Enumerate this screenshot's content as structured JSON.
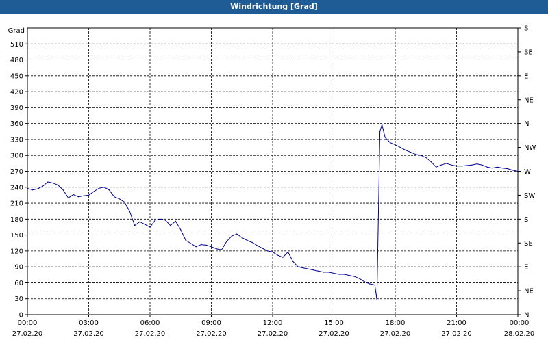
{
  "window": {
    "title": "Windrichtung [Grad]"
  },
  "chart_data": {
    "type": "line",
    "title": "Windrichtung [Grad]",
    "ylabel": "Grad",
    "ylim": [
      0,
      540
    ],
    "yticks": [
      0,
      30,
      60,
      90,
      120,
      150,
      180,
      210,
      240,
      270,
      300,
      330,
      360,
      390,
      420,
      450,
      480,
      510
    ],
    "x_range_hours": [
      0,
      24
    ],
    "x_ticks": [
      {
        "time": "00:00",
        "date": "27.02.20"
      },
      {
        "time": "03:00",
        "date": "27.02.20"
      },
      {
        "time": "06:00",
        "date": "27.02.20"
      },
      {
        "time": "09:00",
        "date": "27.02.20"
      },
      {
        "time": "12:00",
        "date": "27.02.20"
      },
      {
        "time": "15:00",
        "date": "27.02.20"
      },
      {
        "time": "18:00",
        "date": "27.02.20"
      },
      {
        "time": "21:00",
        "date": "27.02.20"
      },
      {
        "time": "00:00",
        "date": "28.02.20"
      }
    ],
    "right_axis_labels": [
      "N",
      "NE",
      "E",
      "SE",
      "S",
      "SW",
      "W",
      "NW",
      "N",
      "NE",
      "E",
      "SE",
      "S"
    ],
    "grid": true,
    "color": "#00008b",
    "series": [
      {
        "x": [
          0,
          0.25,
          0.5,
          0.75,
          1.0,
          1.25,
          1.5,
          1.75,
          2.0,
          2.25,
          2.5,
          2.75,
          3.0,
          3.25,
          3.5,
          3.75,
          4.0,
          4.25,
          4.5,
          4.75,
          5.0,
          5.25,
          5.5,
          5.75,
          6.0,
          6.25,
          6.5,
          6.75,
          7.0,
          7.25,
          7.5,
          7.75,
          8.0,
          8.25,
          8.5,
          8.75,
          9.0,
          9.25,
          9.5,
          9.75,
          10.0,
          10.25,
          10.5,
          10.75,
          11.0,
          11.25,
          11.5,
          11.75,
          12.0,
          12.25,
          12.5,
          12.75,
          13.0,
          13.25,
          13.5,
          13.75,
          14.0,
          14.25,
          14.5,
          14.75,
          15.0,
          15.25,
          15.5,
          15.75,
          16.0,
          16.25,
          16.5,
          16.75,
          17.0,
          17.1,
          17.25,
          17.35,
          17.5,
          17.75,
          18.0,
          18.25,
          18.5,
          18.75,
          19.0,
          19.25,
          19.5,
          19.75,
          20.0,
          20.25,
          20.5,
          20.75,
          21.0,
          21.25,
          21.5,
          21.75,
          22.0,
          22.25,
          22.5,
          22.75,
          23.0,
          23.25,
          23.5,
          23.75,
          24.0
        ],
        "y": [
          238,
          235,
          237,
          242,
          250,
          248,
          244,
          235,
          220,
          226,
          222,
          224,
          225,
          232,
          238,
          240,
          235,
          222,
          218,
          212,
          195,
          168,
          175,
          170,
          165,
          178,
          180,
          178,
          168,
          176,
          160,
          140,
          134,
          128,
          132,
          131,
          128,
          124,
          122,
          138,
          148,
          152,
          145,
          140,
          136,
          130,
          125,
          120,
          118,
          112,
          108,
          118,
          100,
          90,
          88,
          86,
          84,
          82,
          80,
          80,
          78,
          76,
          76,
          74,
          72,
          68,
          62,
          58,
          56,
          28,
          345,
          358,
          334,
          324,
          320,
          315,
          310,
          306,
          302,
          300,
          296,
          288,
          278,
          282,
          285,
          282,
          280,
          280,
          281,
          282,
          284,
          282,
          278,
          276,
          278,
          276,
          275,
          272,
          270
        ]
      }
    ]
  }
}
